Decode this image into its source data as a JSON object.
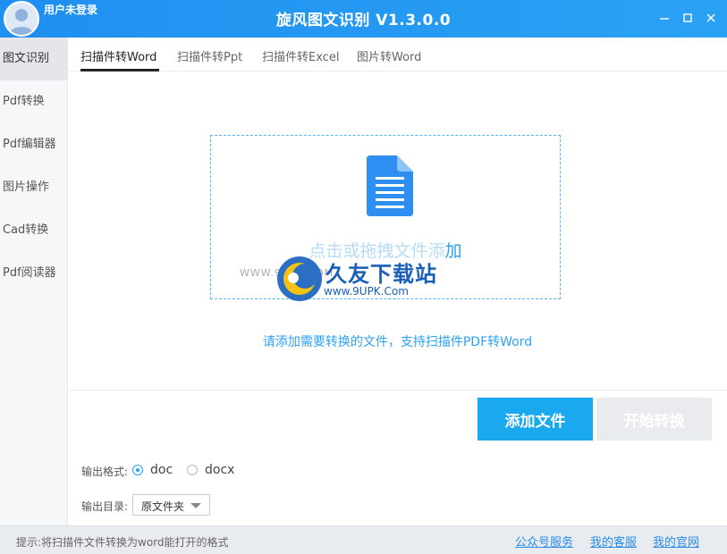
{
  "titlebar": {
    "user_label": "用户未登录",
    "app_title": "旋风图文识别 V1.3.0.0",
    "controls": {
      "minimize": "minimize-icon",
      "maximize": "maximize-icon",
      "close": "close-icon"
    }
  },
  "sidebar": {
    "items": [
      {
        "label": "图文识别",
        "active": true
      },
      {
        "label": "Pdf转换",
        "active": false
      },
      {
        "label": "Pdf编辑器",
        "active": false
      },
      {
        "label": "图片操作",
        "active": false
      },
      {
        "label": "Cad转换",
        "active": false
      },
      {
        "label": "Pdf阅读器",
        "active": false
      }
    ]
  },
  "tabs": [
    {
      "label": "扫描件转Word",
      "active": true
    },
    {
      "label": "扫描件转Ppt",
      "active": false
    },
    {
      "label": "扫描件转Excel",
      "active": false
    },
    {
      "label": "图片转Word",
      "active": false
    }
  ],
  "dropzone": {
    "text_faded": "点击或拖拽文件添",
    "text_strong": "加",
    "icon": "document-icon"
  },
  "watermark": {
    "www": "WWW.9UPK.COM",
    "name": "久友下载站",
    "url": "www.9UPK.Com"
  },
  "hint": "请添加需要转换的文件，支持扫描件PDF转Word",
  "buttons": {
    "add_file": "添加文件",
    "start_convert": "开始转换"
  },
  "output_format": {
    "label": "输出格式:",
    "options": [
      {
        "label": "doc",
        "checked": true
      },
      {
        "label": "docx",
        "checked": false
      }
    ]
  },
  "output_dir": {
    "label": "输出目录:",
    "selected": "原文件夹"
  },
  "statusbar": {
    "tip": "提示:将扫描件文件转换为word能打开的格式",
    "links": [
      "公众号服务",
      "我的客服",
      "我的官网"
    ]
  },
  "colors": {
    "accent": "#2aa2f4",
    "titlebar": "#1f8ff0",
    "disabled_button": "#e9ebee"
  }
}
